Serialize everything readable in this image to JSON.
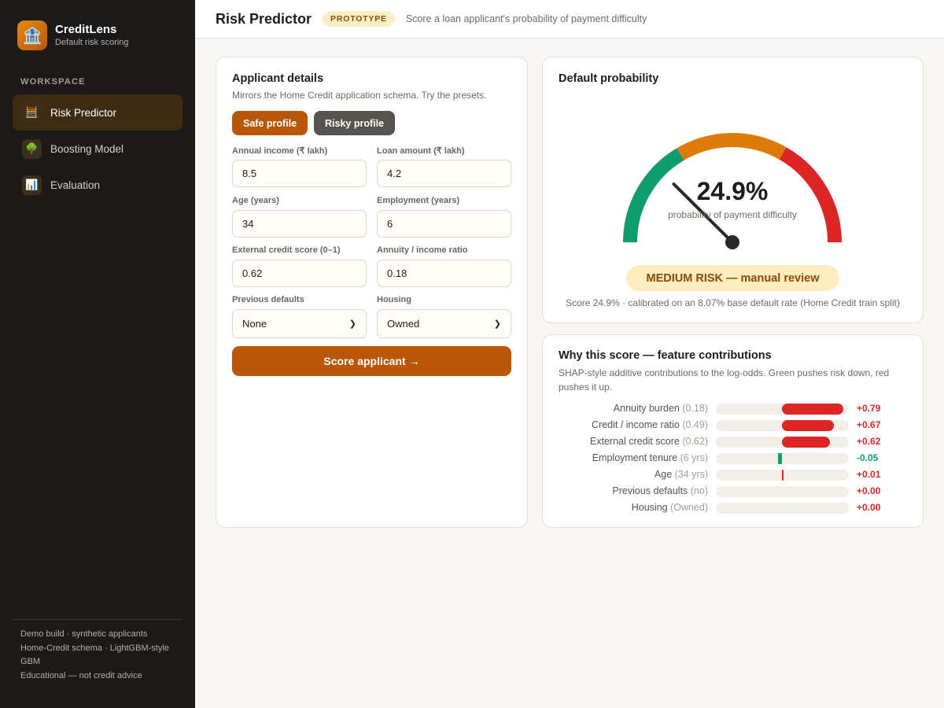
{
  "brand": {
    "name": "CreditLens",
    "subtitle": "Default risk scoring",
    "logo_icon": "bank-icon"
  },
  "sidebar": {
    "section_label": "WORKSPACE",
    "items": [
      {
        "label": "Risk Predictor",
        "icon": "abacus-icon",
        "active": true
      },
      {
        "label": "Boosting Model",
        "icon": "tree-icon",
        "active": false
      },
      {
        "label": "Evaluation",
        "icon": "bar-chart-icon",
        "active": false
      }
    ],
    "footer": {
      "line1": "Demo build · synthetic applicants",
      "line2": "Home-Credit schema · LightGBM-style GBM",
      "line3": "Educational — not credit advice"
    }
  },
  "header": {
    "title": "Risk Predictor",
    "badge": "PROTOTYPE",
    "subtitle": "Score a loan applicant's probability of payment difficulty"
  },
  "applicant": {
    "title": "Applicant details",
    "subtitle": "Mirrors the Home Credit application schema. Try the presets.",
    "safe_label": "Safe profile",
    "risky_label": "Risky profile",
    "fields": {
      "income": {
        "label": "Annual income (₹ lakh)",
        "value": "8.5"
      },
      "loan": {
        "label": "Loan amount (₹ lakh)",
        "value": "4.2"
      },
      "age": {
        "label": "Age (years)",
        "value": "34"
      },
      "employment": {
        "label": "Employment (years)",
        "value": "6"
      },
      "ext_score": {
        "label": "External credit score (0–1)",
        "value": "0.62"
      },
      "annuity": {
        "label": "Annuity / income ratio",
        "value": "0.18"
      },
      "prev_defaults": {
        "label": "Previous defaults",
        "value": "None"
      },
      "housing": {
        "label": "Housing",
        "value": "Owned"
      }
    },
    "score_label": "Score applicant →"
  },
  "probability": {
    "title": "Default probability",
    "value": "24.9%",
    "value_fraction": 0.249,
    "caption": "probability of payment difficulty",
    "risk_label": "MEDIUM RISK — manual review",
    "note": "Score 24.9% · calibrated on an 8.07% base default rate (Home Credit train split)",
    "colors": {
      "low": "#0f9d6e",
      "medium": "#dc7b08",
      "high": "#dc2626",
      "needle": "#2a2724"
    }
  },
  "contributions": {
    "title": "Why this score — feature contributions",
    "subtitle": "SHAP-style additive contributions to the log-odds. Green pushes risk down, red pushes it up.",
    "rows": [
      {
        "name": "Annuity burden",
        "detail": "(0.18)",
        "value": 0.79,
        "value_label": "+0.79"
      },
      {
        "name": "Credit / income ratio",
        "detail": "(0.49)",
        "value": 0.67,
        "value_label": "+0.67"
      },
      {
        "name": "External credit score",
        "detail": "(0.62)",
        "value": 0.62,
        "value_label": "+0.62"
      },
      {
        "name": "Employment tenure",
        "detail": "(6 yrs)",
        "value": -0.05,
        "value_label": "-0.05"
      },
      {
        "name": "Age",
        "detail": "(34 yrs)",
        "value": 0.01,
        "value_label": "+0.01"
      },
      {
        "name": "Previous defaults",
        "detail": "(no)",
        "value": 0.0,
        "value_label": "+0.00"
      },
      {
        "name": "Housing",
        "detail": "(Owned)",
        "value": 0.0,
        "value_label": "+0.00"
      }
    ],
    "colors": {
      "positive": "#dc2626",
      "negative": "#0f9d6e"
    }
  }
}
